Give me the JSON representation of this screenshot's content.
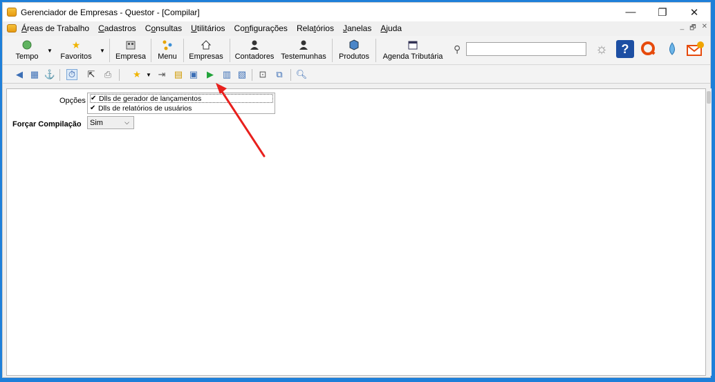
{
  "window": {
    "title": "Gerenciador de Empresas - Questor - [Compilar]",
    "minimize": "—",
    "maximize": "❐",
    "close": "✕"
  },
  "menu": {
    "items": [
      {
        "pre": "",
        "ul": "Á",
        "post": "reas de Trabalho"
      },
      {
        "pre": "",
        "ul": "C",
        "post": "adastros"
      },
      {
        "pre": "C",
        "ul": "o",
        "post": "nsultas"
      },
      {
        "pre": "",
        "ul": "U",
        "post": "tilitários"
      },
      {
        "pre": "Co",
        "ul": "n",
        "post": "figurações"
      },
      {
        "pre": "Rela",
        "ul": "t",
        "post": "órios"
      },
      {
        "pre": "",
        "ul": "J",
        "post": "anelas"
      },
      {
        "pre": "",
        "ul": "A",
        "post": "juda"
      }
    ],
    "mdi_min": "_",
    "mdi_restore": "🗗",
    "mdi_close": "✕"
  },
  "toolbar": {
    "tempo": "Tempo",
    "favoritos": "Favoritos",
    "empresa": "Empresa",
    "menu": "Menu",
    "empresas": "Empresas",
    "contadores": "Contadores",
    "testemunhas": "Testemunhas",
    "produtos": "Produtos",
    "agenda": "Agenda Tributária"
  },
  "form": {
    "opcoes_label": "Opções",
    "opcoes": [
      "Dlls de gerador de lançamentos",
      "Dlls de relatórios de usuários"
    ],
    "forcar_label": "Forçar Compilação",
    "forcar_value": "Sim"
  },
  "colors": {
    "frame": "#1e7fd9",
    "arrow": "#e8201d",
    "play": "#21a33a"
  }
}
